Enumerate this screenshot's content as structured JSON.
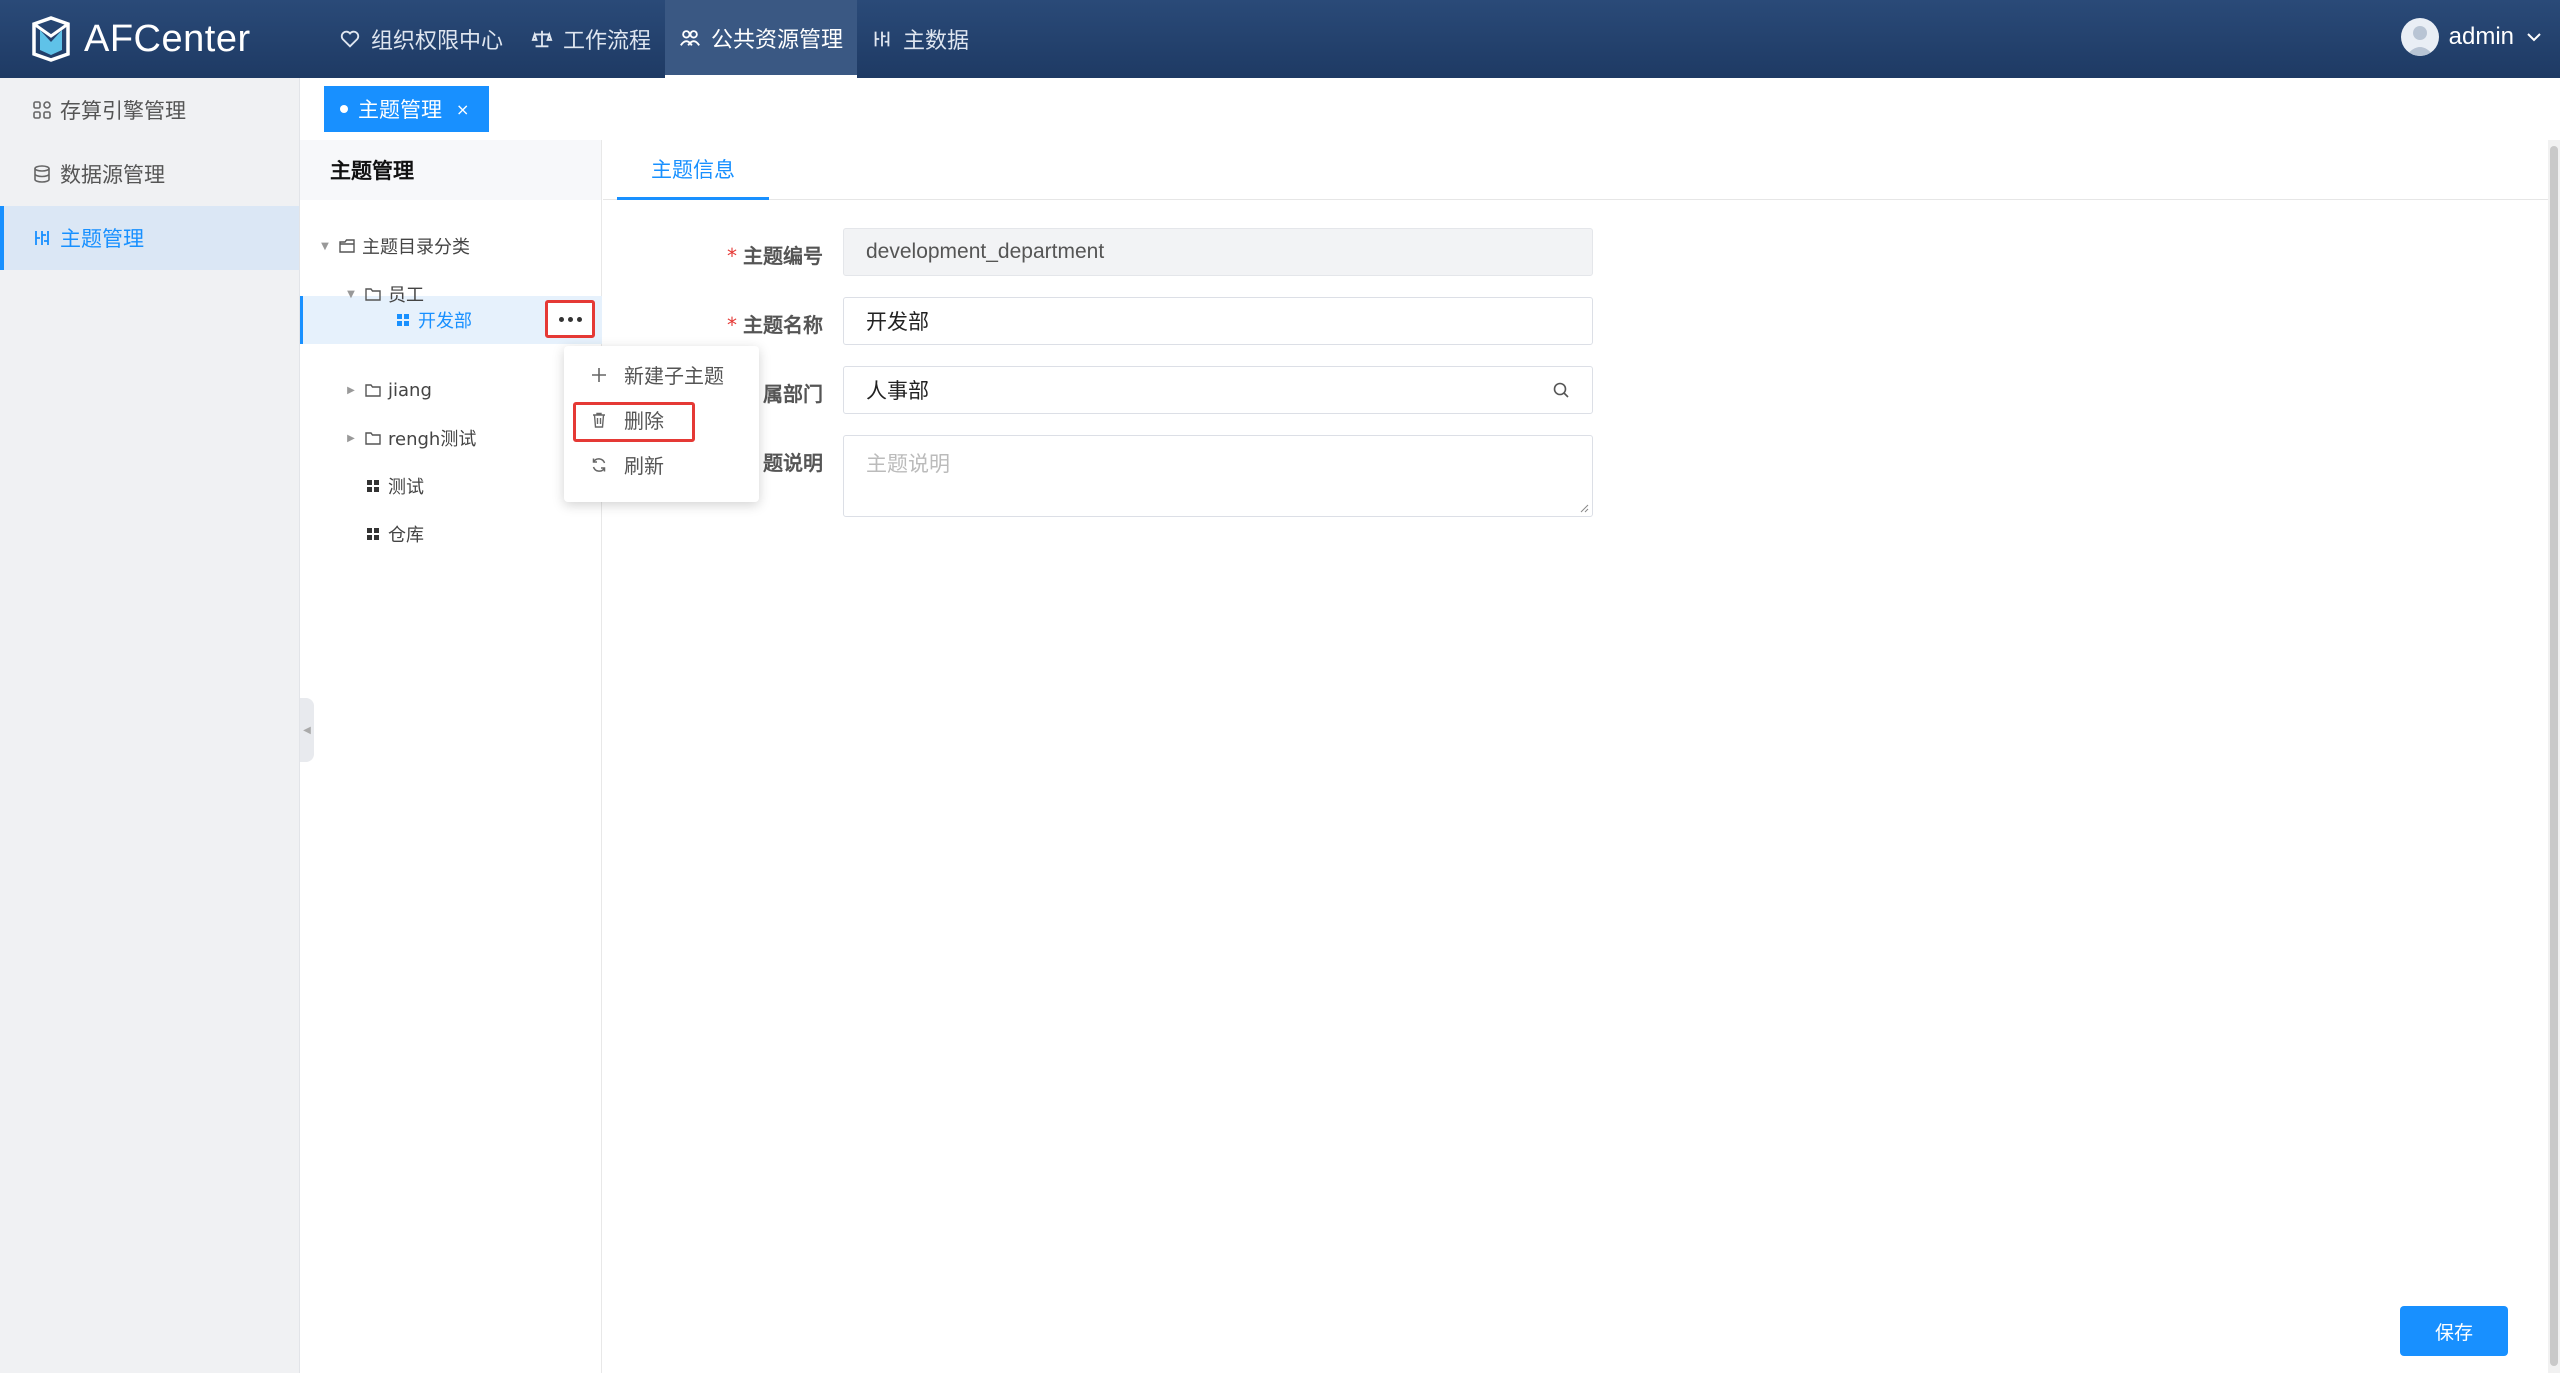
{
  "app": {
    "name": "AFCenter"
  },
  "nav": {
    "items": [
      {
        "label": "组织权限中心",
        "icon": "heart-shield-icon"
      },
      {
        "label": "工作流程",
        "icon": "scale-icon"
      },
      {
        "label": "公共资源管理",
        "icon": "users-icon",
        "active": true
      },
      {
        "label": "主数据",
        "icon": "data-icon"
      }
    ]
  },
  "user": {
    "name": "admin"
  },
  "sidebar": {
    "items": [
      {
        "label": "存算引擎管理",
        "icon": "grid-icon"
      },
      {
        "label": "数据源管理",
        "icon": "database-icon"
      },
      {
        "label": "主题管理",
        "icon": "topic-icon",
        "active": true
      }
    ]
  },
  "tabs": {
    "open": [
      {
        "label": "主题管理",
        "close": "×"
      }
    ]
  },
  "tree": {
    "title": "主题管理",
    "nodes": [
      {
        "label": "主题目录分类",
        "level": 0,
        "expanded": true,
        "icon": "folder-icon"
      },
      {
        "label": "员工",
        "level": 1,
        "expanded": true,
        "icon": "folder-open-icon"
      },
      {
        "label": "开发部",
        "level": 2,
        "selected": true,
        "icon": "grid-icon"
      },
      {
        "label": "jiang",
        "level": 1,
        "expanded": false,
        "icon": "folder-open-icon"
      },
      {
        "label": "rengh测试",
        "level": 1,
        "expanded": false,
        "icon": "folder-open-icon"
      },
      {
        "label": "测试",
        "level": 1,
        "icon": "grid-icon"
      },
      {
        "label": "仓库",
        "level": 1,
        "icon": "grid-icon"
      }
    ]
  },
  "context_menu": {
    "items": [
      {
        "label": "新建子主题",
        "icon": "plus-icon"
      },
      {
        "label": "删除",
        "icon": "trash-icon"
      },
      {
        "label": "刷新",
        "icon": "refresh-icon"
      }
    ]
  },
  "main": {
    "tab": "主题信息",
    "form": {
      "code": {
        "label": "主题编号",
        "required": true,
        "value": "development_department"
      },
      "name": {
        "label": "主题名称",
        "required": true,
        "value": "开发部"
      },
      "dept": {
        "label": "属部门",
        "value": "人事部"
      },
      "desc": {
        "label": "题说明",
        "placeholder": "主题说明"
      }
    },
    "save_label": "保存"
  },
  "colors": {
    "primary": "#1890ff",
    "topbar": "#1e3a64",
    "highlight": "#e53935"
  }
}
